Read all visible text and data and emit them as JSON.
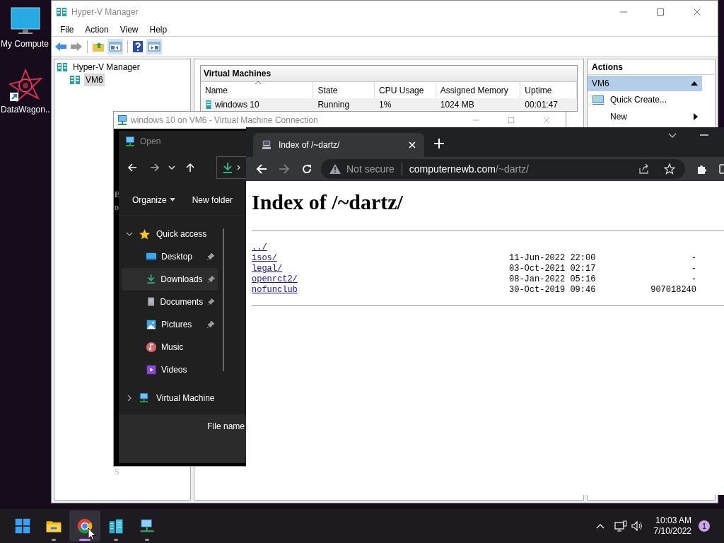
{
  "desktop_icons": [
    {
      "label": "My Compute"
    },
    {
      "label": "DataWagon.."
    }
  ],
  "hyperv": {
    "title": "Hyper-V Manager",
    "menu": [
      "File",
      "Action",
      "View",
      "Help"
    ],
    "tree": [
      {
        "label": "Hyper-V Manager",
        "selected": false,
        "children": [
          {
            "label": "VM6",
            "selected": true
          }
        ]
      }
    ],
    "vm_section_title": "Virtual Machines",
    "columns": [
      "Name",
      "State",
      "CPU Usage",
      "Assigned Memory",
      "Uptime"
    ],
    "rows": [
      {
        "cells": [
          "windows 10",
          "Running",
          "1%",
          "1024 MB",
          "00:01:47"
        ]
      }
    ],
    "actions_title": "Actions",
    "actions_group": "VM6",
    "actions": [
      {
        "label": "Quick Create...",
        "kind": "item"
      },
      {
        "label": "New",
        "kind": "submenu"
      }
    ]
  },
  "vm_connection": {
    "title": "windows 10 on VM6 - Virtual Machine Connection",
    "guest_text": [
      "B",
      "o",
      "S"
    ]
  },
  "open_dialog": {
    "title": "Open",
    "organize": "Organize",
    "new_folder": "New folder",
    "navigation": [
      {
        "label": "Quick access",
        "expanded": true,
        "selected": false,
        "children": [
          {
            "label": "Desktop",
            "pinned": true,
            "selected": false
          },
          {
            "label": "Downloads",
            "pinned": true,
            "selected": true
          },
          {
            "label": "Documents",
            "pinned": true,
            "selected": false
          },
          {
            "label": "Pictures",
            "pinned": true,
            "selected": false
          },
          {
            "label": "Music",
            "pinned": false,
            "selected": false
          },
          {
            "label": "Videos",
            "pinned": false,
            "selected": false
          }
        ]
      },
      {
        "label": "Virtual Machine",
        "expanded": false,
        "selected": false
      }
    ],
    "file_name_label": "File name"
  },
  "browser": {
    "tab_title": "Index of /~dartz/",
    "security": "Not secure",
    "url_host": "computernewb.com",
    "url_path": "/~dartz/",
    "heading": "Index of /~dartz/",
    "listing": [
      {
        "name": "../"
      },
      {
        "name": "isos/",
        "date": "11-Jun-2022 22:00",
        "size": "-"
      },
      {
        "name": "legal/",
        "date": "03-Oct-2021 02:17",
        "size": "-"
      },
      {
        "name": "openrct2/",
        "date": "08-Jan-2022 05:16",
        "size": "-"
      },
      {
        "name": "nofunclub",
        "date": "30-Oct-2019 09:46",
        "size": "907018240"
      }
    ]
  },
  "taskbar": {
    "apps": [
      {
        "running": false,
        "selected": false
      },
      {
        "running": true,
        "selected": false
      },
      {
        "running": true,
        "selected": true
      },
      {
        "running": true,
        "selected": false
      },
      {
        "running": true,
        "selected": false
      }
    ],
    "time": "10:03 AM",
    "date": "7/10/2022",
    "notifications": "1"
  }
}
